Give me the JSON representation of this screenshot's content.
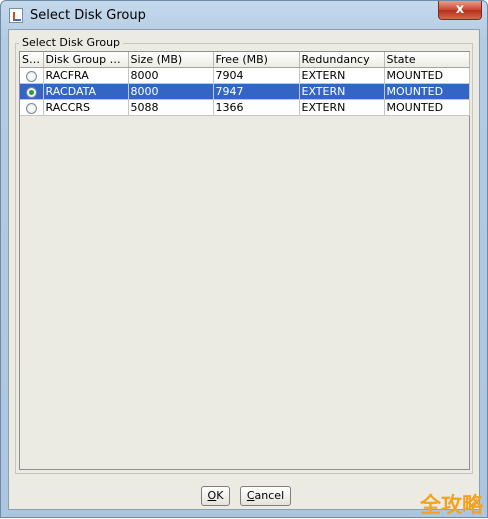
{
  "window": {
    "title": "Select Disk Group",
    "close_glyph": "x"
  },
  "group": {
    "title": "Select Disk Group"
  },
  "table": {
    "columns": [
      "Se...",
      "Disk Group N...",
      "Size (MB)",
      "Free (MB)",
      "Redundancy",
      "State"
    ],
    "rows": [
      {
        "selected": false,
        "name": "RACFRA",
        "size": "8000",
        "free": "7904",
        "redundancy": "EXTERN",
        "state": "MOUNTED"
      },
      {
        "selected": true,
        "name": "RACDATA",
        "size": "8000",
        "free": "7947",
        "redundancy": "EXTERN",
        "state": "MOUNTED"
      },
      {
        "selected": false,
        "name": "RACCRS",
        "size": "5088",
        "free": "1366",
        "redundancy": "EXTERN",
        "state": "MOUNTED"
      }
    ]
  },
  "buttons": {
    "ok": {
      "mnemonic": "O",
      "rest": "K"
    },
    "cancel": {
      "mnemonic": "C",
      "rest": "ancel"
    }
  },
  "watermark": "全攻略",
  "colors": {
    "selection": "#3366c4",
    "radio_checked": "#2e9b3b",
    "close_button": "#c8452e",
    "watermark": "#f3a321"
  },
  "icons": {
    "app": "java-coffee-cup-icon",
    "close": "close-icon",
    "radio_on": "radio-checked-icon",
    "radio_off": "radio-unchecked-icon"
  }
}
